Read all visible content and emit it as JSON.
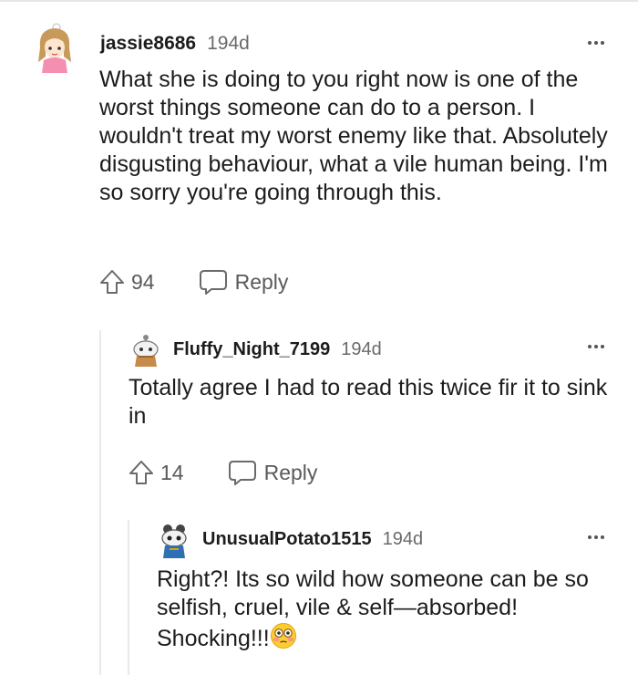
{
  "comments": [
    {
      "username": "jassie8686",
      "time": "194d",
      "text": "What she is doing to you right now is one of the worst things someone can do to a person. I wouldn't treat my worst enemy like that. Absolutely disgusting behaviour, what a vile human being. I'm so sorry you're going through this.",
      "upvotes": "94",
      "reply_label": "Reply",
      "avatar_icon": "anime-girl-avatar-icon"
    },
    {
      "username": "Fluffy_Night_7199",
      "time": "194d",
      "text": "Totally agree I had to read this twice fir it to sink in",
      "upvotes": "14",
      "reply_label": "Reply",
      "avatar_icon": "snoo-avatar-icon"
    },
    {
      "username": "UnusualPotato1515",
      "time": "194d",
      "text": "Right?! Its so wild how someone can be so selfish, cruel, vile & self—absorbed! Shocking!!!",
      "emoji": "😳",
      "avatar_icon": "snoo-avatar-icon"
    }
  ],
  "colors": {
    "meta_gray": "#6a6a6a",
    "thread_line": "#e9e9e9",
    "text": "#1c1c1c"
  }
}
